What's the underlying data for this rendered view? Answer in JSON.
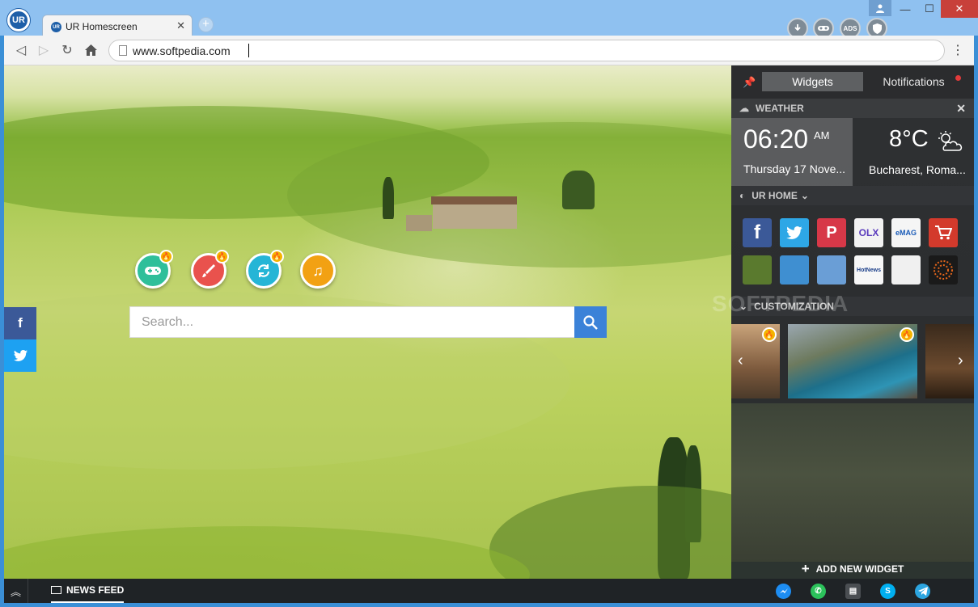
{
  "browser": {
    "tab_title": "UR Homescreen",
    "tab_favicon": "UR",
    "logo": "UR",
    "url": "www.softpedia.com",
    "extensions": [
      "download-icon",
      "mask-icon",
      "ADS",
      "shield-icon"
    ]
  },
  "content": {
    "search": {
      "placeholder": "Search..."
    },
    "quick_icons": [
      {
        "name": "games-icon",
        "color": "#2fbf9a"
      },
      {
        "name": "paint-icon",
        "color": "#e9524d"
      },
      {
        "name": "sync-icon",
        "color": "#25b5d6"
      },
      {
        "name": "music-icon",
        "color": "#f2a113"
      }
    ],
    "social": [
      {
        "name": "facebook-share-icon",
        "glyph": "f",
        "color": "#3b5998"
      },
      {
        "name": "twitter-share-icon",
        "glyph": "t",
        "color": "#1da1f2"
      }
    ]
  },
  "bottom_bar": {
    "news_feed": "NEWS FEED",
    "messengers": [
      {
        "name": "messenger-icon",
        "color": "#1d8df2"
      },
      {
        "name": "whatsapp-icon",
        "color": "#2cc25b"
      },
      {
        "name": "sms-icon",
        "color": "#4a4e52"
      },
      {
        "name": "skype-icon",
        "color": "#00aff0"
      },
      {
        "name": "telegram-icon",
        "color": "#2ca5e0"
      }
    ]
  },
  "panel": {
    "tabs": {
      "widgets": "Widgets",
      "notifications": "Notifications"
    },
    "weather": {
      "header": "WEATHER",
      "time": "06:20",
      "ampm": "AM",
      "date": "Thursday 17 Nove...",
      "temp": "8°C",
      "city": "Bucharest, Roma..."
    },
    "ur_home": {
      "header": "UR HOME"
    },
    "apps": [
      {
        "name": "facebook",
        "label": "f",
        "color": "#3b5998"
      },
      {
        "name": "twitter",
        "label": "t",
        "color": "#2ea7e6"
      },
      {
        "name": "pinterest",
        "label": "P",
        "color": "#d73848"
      },
      {
        "name": "olx",
        "label": "OLX",
        "color": "#f2f2f2"
      },
      {
        "name": "emag",
        "label": "eMAG",
        "color": "#f5f5f5"
      },
      {
        "name": "shop",
        "label": "cart",
        "color": "#d33a2c"
      },
      {
        "name": "game-1",
        "label": "",
        "color": "#5a7a2e"
      },
      {
        "name": "game-2",
        "label": "",
        "color": "#3f8fd1"
      },
      {
        "name": "game-3",
        "label": "",
        "color": "#6a9ed6"
      },
      {
        "name": "hotnews",
        "label": "HotNews",
        "color": "#f7f7f7"
      },
      {
        "name": "magazine",
        "label": "",
        "color": "#f0f0f0"
      },
      {
        "name": "radial-app",
        "label": "",
        "color": "#1a1a1a"
      }
    ],
    "customization": {
      "header": "CUSTOMIZATION"
    },
    "add_widget": "ADD NEW WIDGET"
  },
  "watermark": "SOFTPEDIA"
}
